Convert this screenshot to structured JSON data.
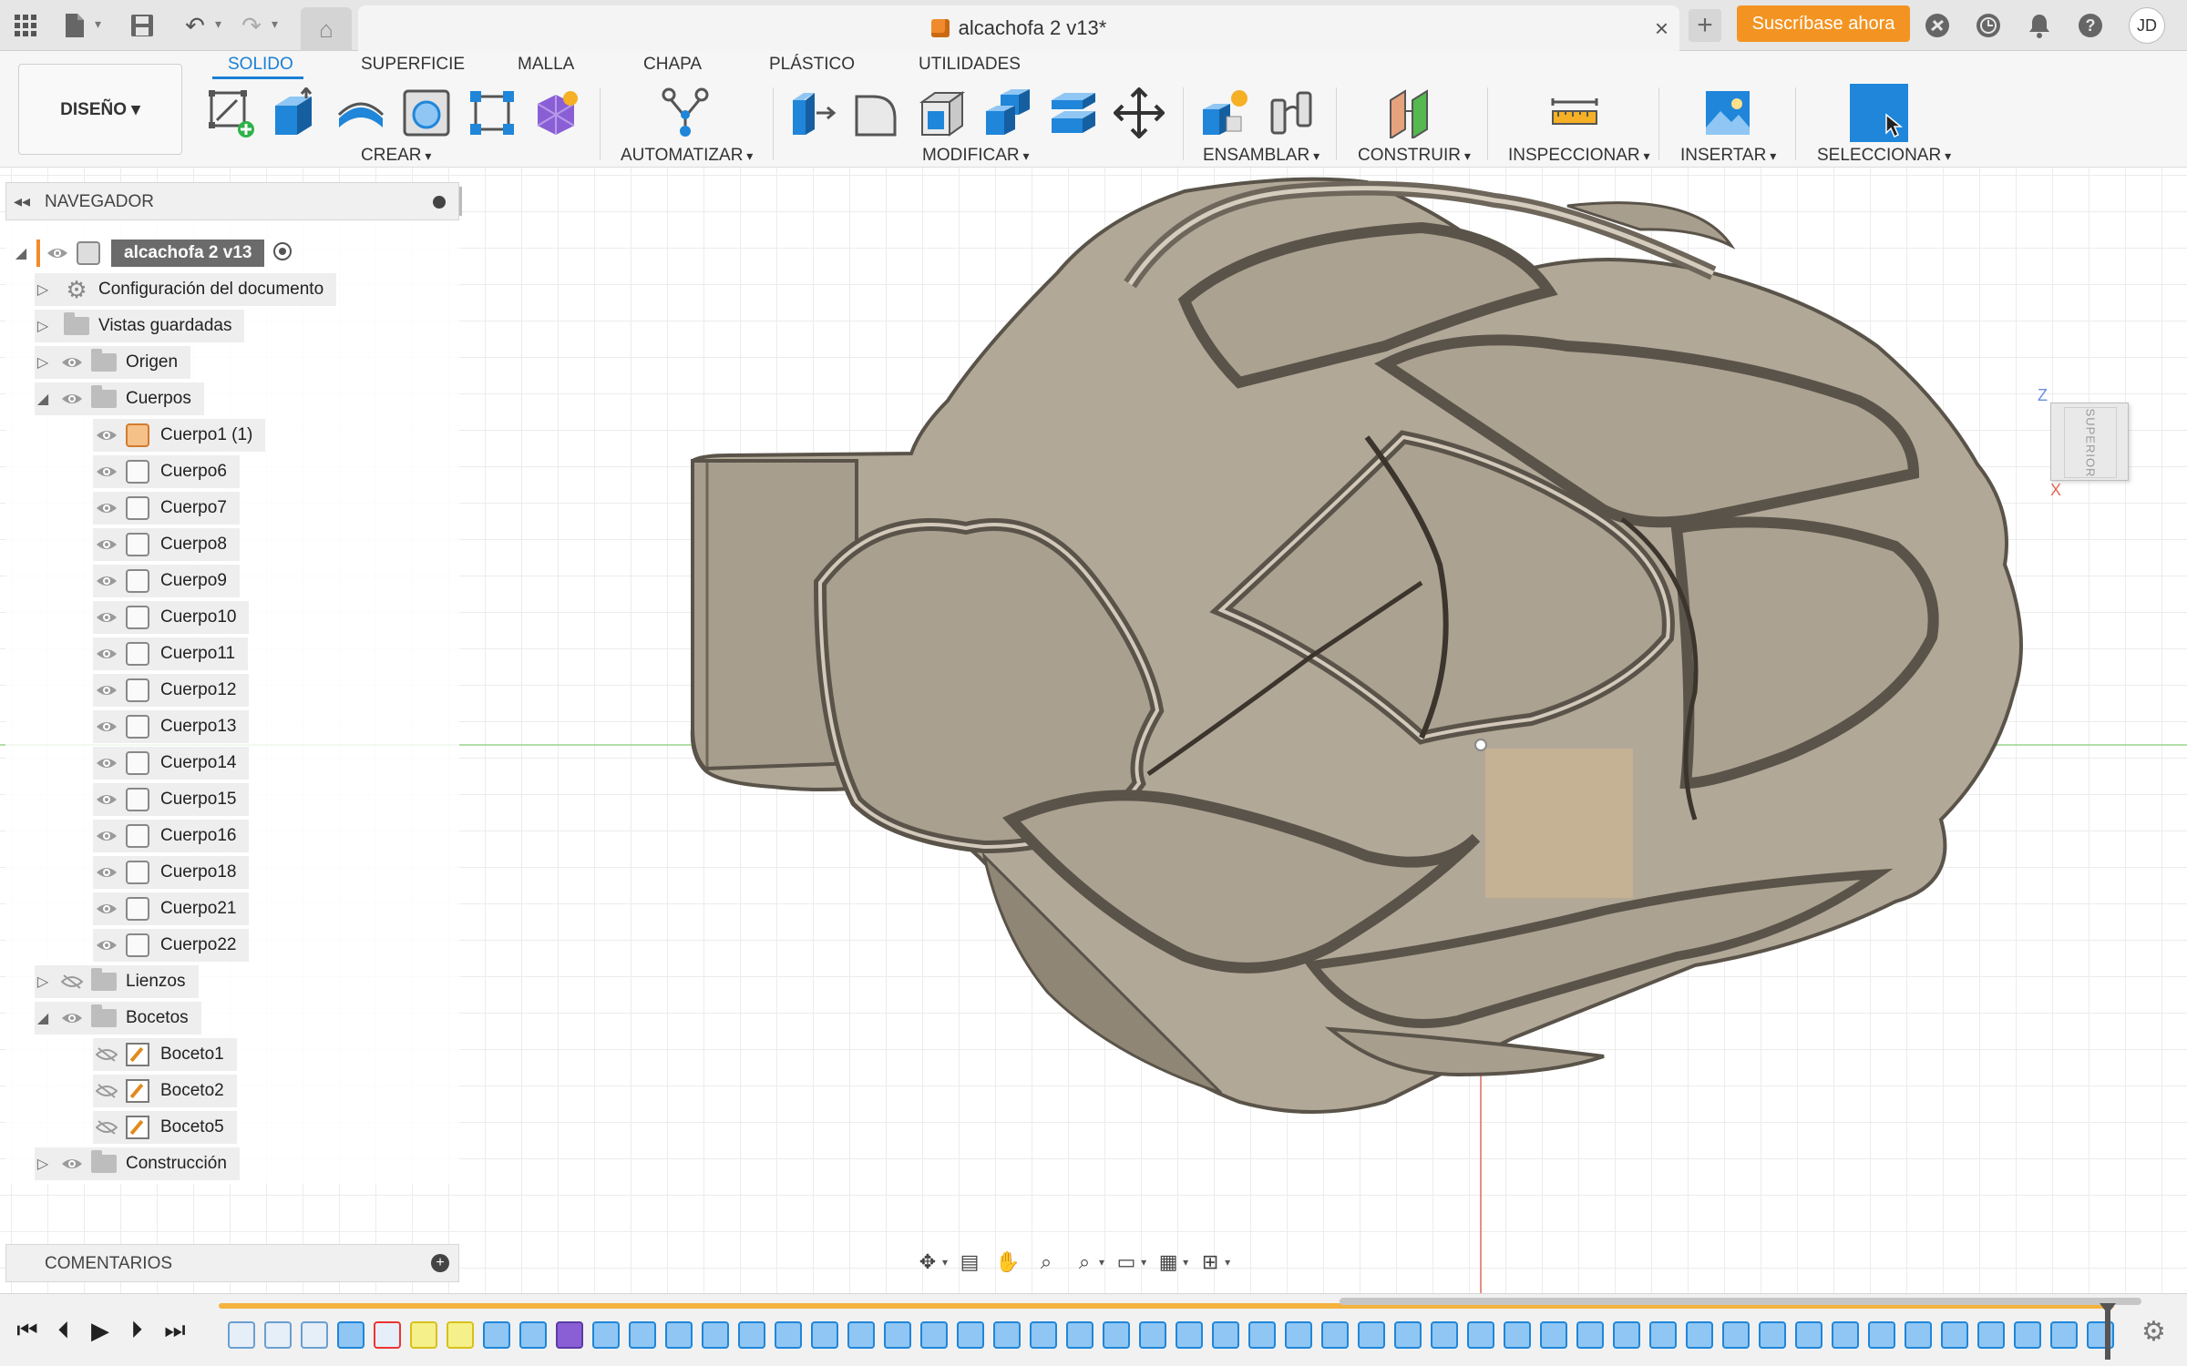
{
  "window": {
    "doc_title": "alcachofa 2 v13*",
    "subscribe_label": "Suscríbase ahora",
    "user_initials": "JD"
  },
  "workspace": {
    "design_label": "DISEÑO ▾"
  },
  "tabs": [
    {
      "label": "SOLIDO",
      "active": true
    },
    {
      "label": "SUPERFICIE"
    },
    {
      "label": "MALLA"
    },
    {
      "label": "CHAPA"
    },
    {
      "label": "PLÁSTICO"
    },
    {
      "label": "UTILIDADES"
    }
  ],
  "tool_groups": [
    {
      "label": "CREAR"
    },
    {
      "label": "AUTOMATIZAR"
    },
    {
      "label": "MODIFICAR"
    },
    {
      "label": "ENSAMBLAR"
    },
    {
      "label": "CONSTRUIR"
    },
    {
      "label": "INSPECCIONAR"
    },
    {
      "label": "INSERTAR"
    },
    {
      "label": "SELECCIONAR"
    }
  ],
  "navigator": {
    "title": "NAVEGADOR",
    "root": "alcachofa 2 v13",
    "items": [
      {
        "label": "Configuración del documento"
      },
      {
        "label": "Vistas guardadas"
      },
      {
        "label": "Origen"
      },
      {
        "label": "Cuerpos"
      },
      {
        "label": "Cuerpo1 (1)"
      },
      {
        "label": "Cuerpo6"
      },
      {
        "label": "Cuerpo7"
      },
      {
        "label": "Cuerpo8"
      },
      {
        "label": "Cuerpo9"
      },
      {
        "label": "Cuerpo10"
      },
      {
        "label": "Cuerpo11"
      },
      {
        "label": "Cuerpo12"
      },
      {
        "label": "Cuerpo13"
      },
      {
        "label": "Cuerpo14"
      },
      {
        "label": "Cuerpo15"
      },
      {
        "label": "Cuerpo16"
      },
      {
        "label": "Cuerpo18"
      },
      {
        "label": "Cuerpo21"
      },
      {
        "label": "Cuerpo22"
      },
      {
        "label": "Lienzos"
      },
      {
        "label": "Bocetos"
      },
      {
        "label": "Boceto1"
      },
      {
        "label": "Boceto2"
      },
      {
        "label": "Boceto5"
      },
      {
        "label": "Construcción"
      }
    ]
  },
  "comments": {
    "title": "COMENTARIOS"
  },
  "viewcube": {
    "face_label": "SUPERIOR",
    "axis_z": "Z",
    "axis_x": "X"
  },
  "colors": {
    "accent": "#1b7fd4",
    "subscribe": "#f39422",
    "model_fill": "#b2a898",
    "model_edge": "#5a5349",
    "timeline": "#f4b23e"
  }
}
